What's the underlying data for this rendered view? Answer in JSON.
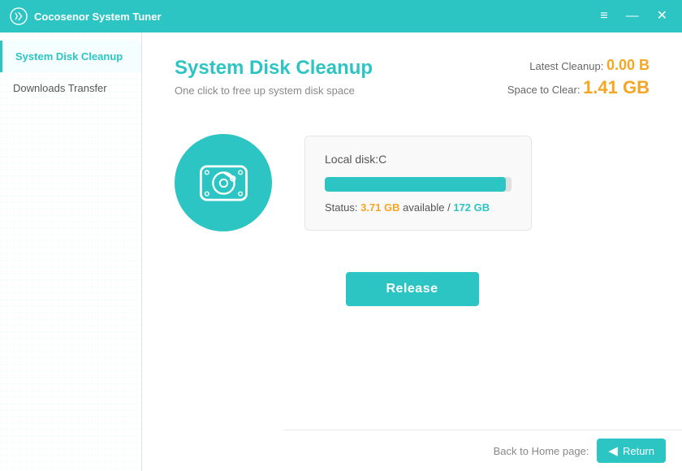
{
  "titlebar": {
    "app_name": "Cocosenor System Tuner",
    "menu_icon": "≡",
    "minimize_icon": "—",
    "close_icon": "✕"
  },
  "sidebar": {
    "items": [
      {
        "id": "system-disk-cleanup",
        "label": "System Disk Cleanup",
        "active": true
      },
      {
        "id": "downloads-transfer",
        "label": "Downloads Transfer",
        "active": false
      }
    ]
  },
  "content": {
    "title": "System Disk Cleanup",
    "subtitle": "One click to free up system disk space",
    "latest_cleanup_label": "Latest Cleanup:",
    "latest_cleanup_value": "0.00 B",
    "space_to_clear_label": "Space to Clear:",
    "space_to_clear_value": "1.41 GB",
    "disk": {
      "label": "Local disk:C",
      "available": "3.71 GB",
      "total": "172 GB",
      "status_prefix": "Status:",
      "status_middle": "available /",
      "fill_percent": 97
    },
    "release_button": "Release",
    "back_label": "Back to Home page:",
    "return_button": "Return"
  }
}
